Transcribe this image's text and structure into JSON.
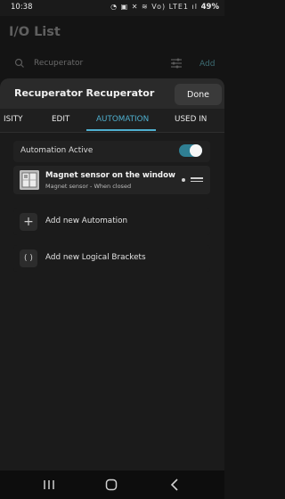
{
  "status_bar": {
    "time": "10:38",
    "icons": "◔ ▣ ✕ ≋ Vo) LTE1 ıl",
    "battery": "49%"
  },
  "background": {
    "title": "I/O List",
    "search_value": "Recuperator",
    "add_label": "Add"
  },
  "sheet": {
    "title": "Recuperator Recuperator",
    "done_label": "Done",
    "tabs": [
      {
        "label": "ISITY"
      },
      {
        "label": "EDIT"
      },
      {
        "label": "AUTOMATION"
      },
      {
        "label": "USED IN"
      }
    ],
    "active_tab": "AUTOMATION",
    "automation_active_label": "Automation Active",
    "automation_active": true,
    "items": [
      {
        "title": "Magnet sensor on the window",
        "subtitle": "Magnet sensor - When closed"
      }
    ],
    "actions": [
      {
        "label": "Add new Automation",
        "icon": "+"
      },
      {
        "label": "Add new Logical Brackets",
        "icon": "( )"
      }
    ]
  },
  "colors": {
    "accent": "#4fb0d0",
    "toggle_on": "#2f7f93"
  }
}
